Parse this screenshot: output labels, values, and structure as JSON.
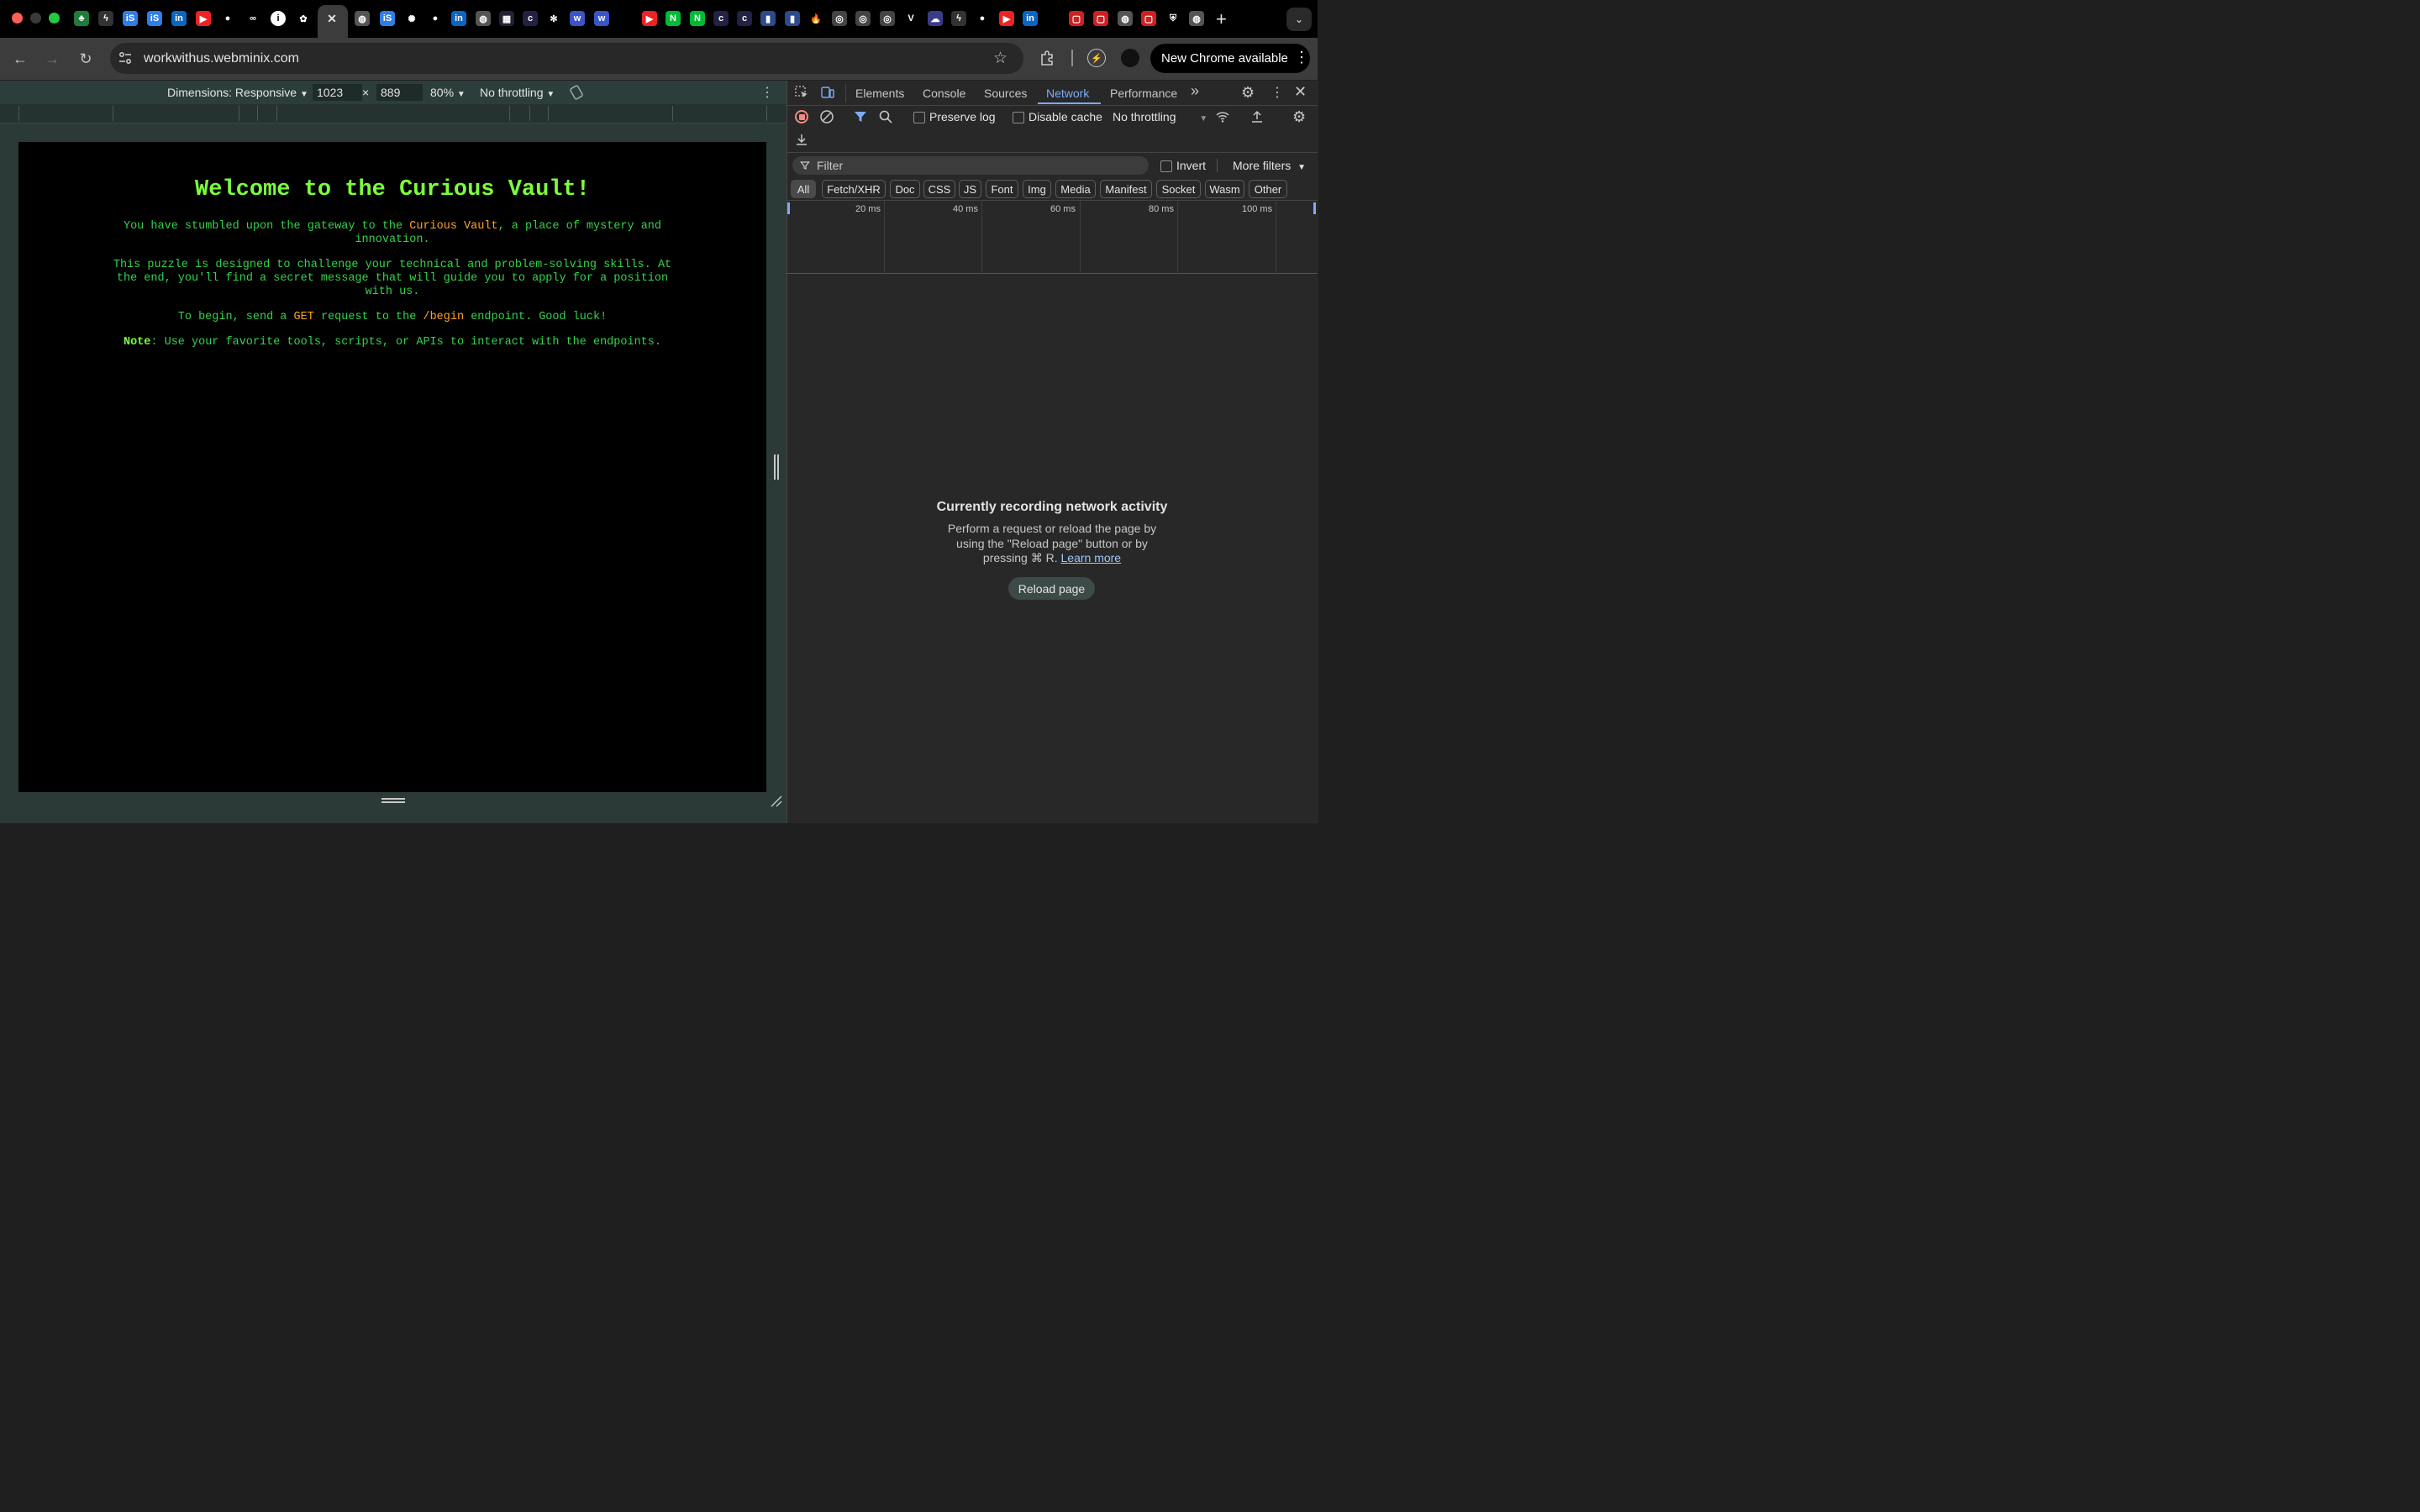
{
  "browser": {
    "url": "workwithus.webminix.com",
    "new_chrome_label": "New Chrome available",
    "tab_favicons": [
      "leaf-icon",
      "bolt-icon",
      "is-icon",
      "is-icon",
      "linkedin-icon",
      "youtube-icon",
      "github-icon",
      "link-icon",
      "info-icon",
      "openai-icon",
      "close-icon",
      "globe-icon",
      "is-icon",
      "sparkle-icon",
      "github-icon",
      "linkedin-icon",
      "globe-icon",
      "grid-icon",
      "c-icon",
      "gear-icon",
      "w-icon",
      "w-icon",
      "youtube-icon",
      "n-icon",
      "n-icon",
      "c-icon",
      "c-icon",
      "doc-icon",
      "doc-icon",
      "flame-icon",
      "ring-icon",
      "ring-icon",
      "ring-icon",
      "v-icon",
      "cloud-icon",
      "bolt-icon",
      "github-icon",
      "youtube-icon",
      "linkedin-icon",
      "box-icon",
      "box-icon",
      "globe-icon",
      "box-icon",
      "shield-icon",
      "globe-icon"
    ],
    "new_tab": "+"
  },
  "device_toolbar": {
    "dimensions": "Dimensions: Responsive",
    "width": "1023",
    "times": "×",
    "height": "889",
    "zoom": "80%",
    "throttling": "No throttling"
  },
  "page": {
    "heading": "Welcome to the Curious Vault!",
    "p1_a": "You have stumbled upon the gateway to the",
    "p1_hl": "Curious Vault",
    "p1_b": ", a place of mystery and",
    "p1_c": "innovation.",
    "p2_a": "This puzzle is designed to challenge your technical and problem-solving skills. At",
    "p2_b": "the end, you'll find a secret message that will guide you to apply for a position",
    "p2_c": "with us.",
    "p3_a": "To begin, send a",
    "p3_hl1": "GET",
    "p3_b": "request to the",
    "p3_hl2": "/begin",
    "p3_c": "endpoint. Good luck!",
    "note_label": "Note",
    "note_text": ": Use your favorite tools, scripts, or APIs to interact with the endpoints."
  },
  "devtools": {
    "tabs": [
      "Elements",
      "Console",
      "Sources",
      "Network",
      "Performance"
    ],
    "active_tab": "Network",
    "more_tabs": "»",
    "preserve_log": "Preserve log",
    "disable_cache": "Disable cache",
    "throttling": "No throttling",
    "filter_placeholder": "Filter",
    "invert": "Invert",
    "more_filters": "More filters",
    "chips": [
      "All",
      "Fetch/XHR",
      "Doc",
      "CSS",
      "JS",
      "Font",
      "Img",
      "Media",
      "Manifest",
      "Socket",
      "Wasm",
      "Other"
    ],
    "ticks": [
      "20 ms",
      "40 ms",
      "60 ms",
      "80 ms",
      "100 ms"
    ],
    "empty_title": "Currently recording network activity",
    "empty_body_1": "Perform a request or reload the page by",
    "empty_body_2": "using the \"Reload page\" button or by",
    "empty_body_3": "pressing ⌘ R.",
    "learn_more": "Learn more",
    "reload_button": "Reload page"
  },
  "colors": {
    "page_green": "#33d34a",
    "heading_green": "#7cfc3c",
    "highlight_orange": "#ffa21f",
    "devtools_accent": "#7cacf8"
  }
}
